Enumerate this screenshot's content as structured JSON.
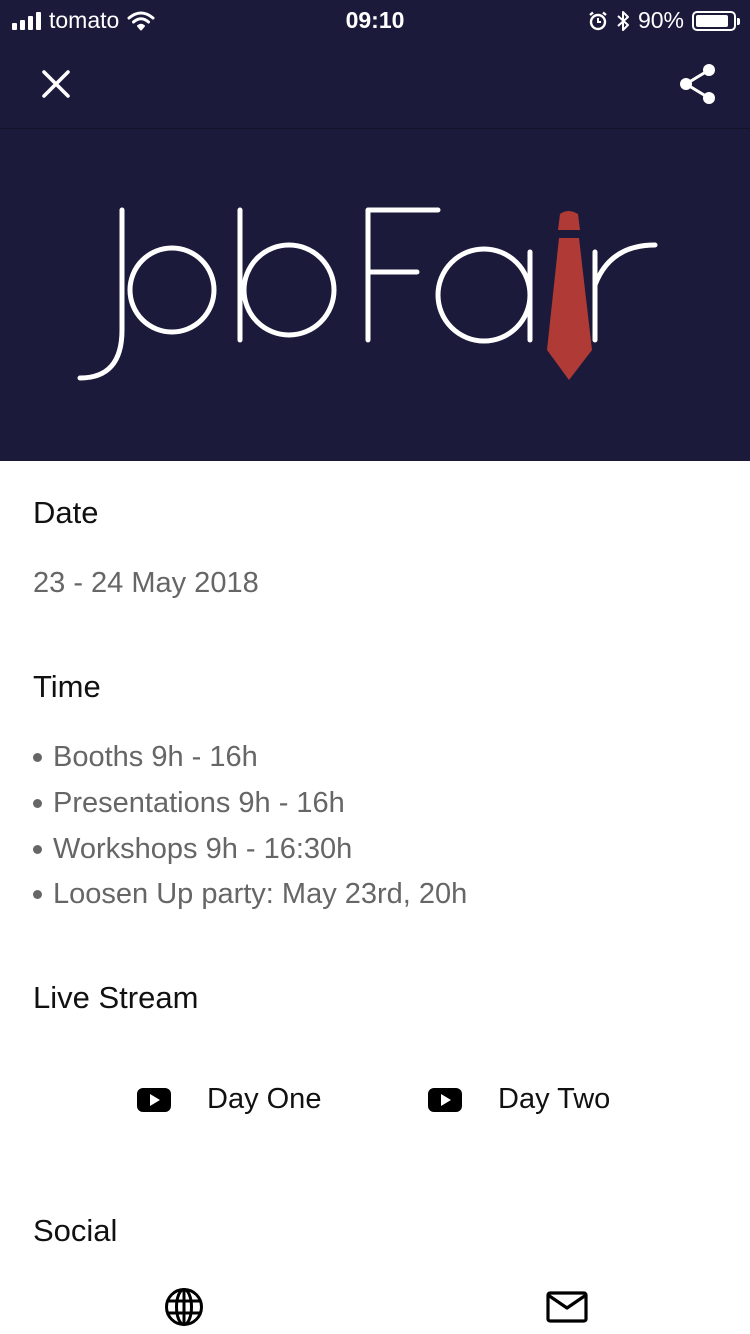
{
  "status": {
    "carrier": "tomato",
    "time": "09:10",
    "battery": "90%",
    "battery_level": 0.9
  },
  "toolbar": {
    "close_icon": "close-icon",
    "share_icon": "share-icon"
  },
  "logo": {
    "text": "JobFair",
    "accent_color": "#b03a35"
  },
  "date": {
    "heading": "Date",
    "value": "23 - 24 May 2018"
  },
  "time": {
    "heading": "Time",
    "items": [
      "Booths 9h - 16h",
      "Presentations 9h - 16h",
      "Workshops 9h - 16:30h",
      "Loosen Up party: May 23rd, 20h"
    ]
  },
  "live_stream": {
    "heading": "Live Stream",
    "buttons": [
      {
        "label": "Day One",
        "icon": "youtube-icon"
      },
      {
        "label": "Day Two",
        "icon": "youtube-icon"
      }
    ]
  },
  "social": {
    "heading": "Social",
    "icons": [
      "globe-icon",
      "mail-icon"
    ]
  },
  "colors": {
    "header_bg": "#1b1a3a",
    "text_primary": "#111111",
    "text_secondary": "#666666"
  }
}
